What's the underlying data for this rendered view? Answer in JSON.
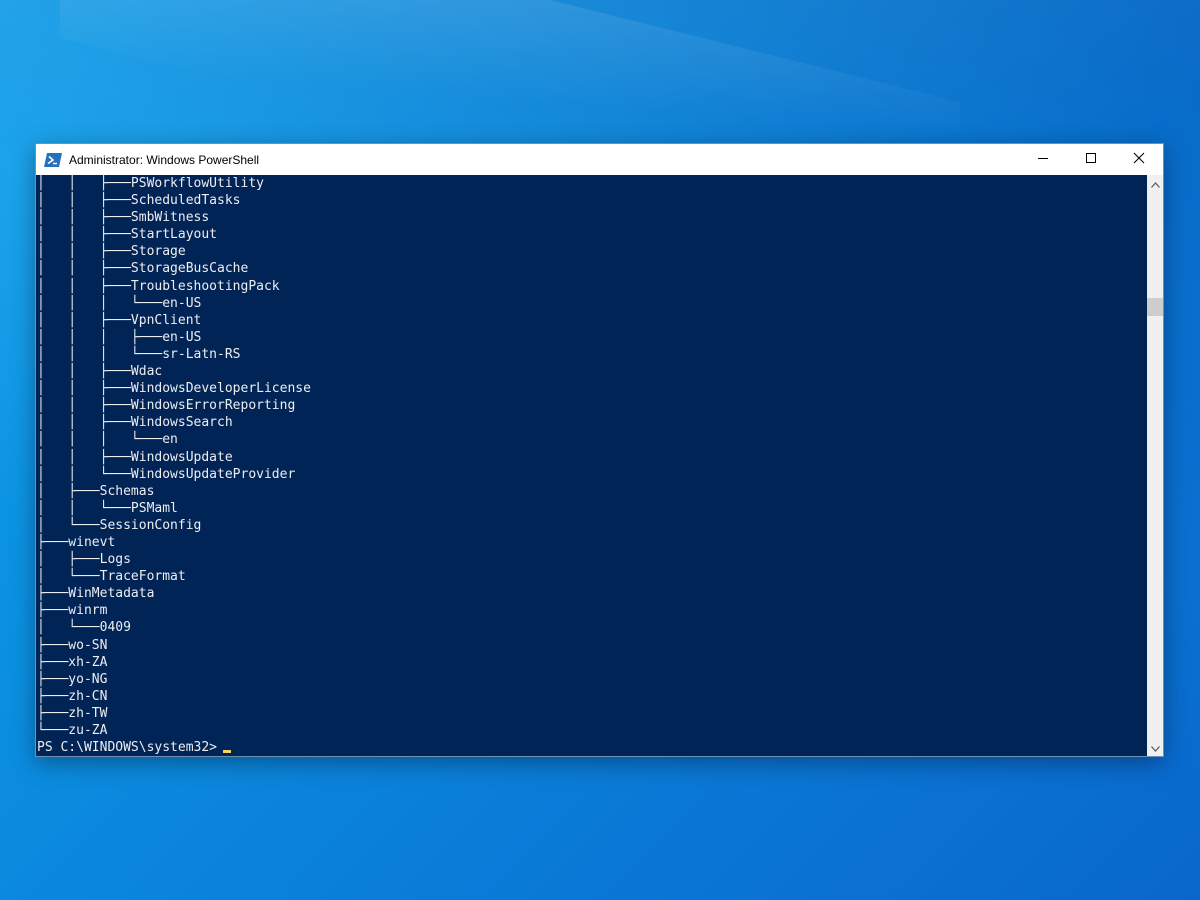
{
  "window": {
    "title": "Administrator: Windows PowerShell",
    "icon": "powershell-icon",
    "controls": [
      "minimize-icon",
      "maximize-icon",
      "close-icon"
    ]
  },
  "terminal": {
    "background": "#012456",
    "text_color": "#eeedf0",
    "cursor_color": "#f2d55c",
    "lines": [
      "│   │   ├───PSWorkflowUtility",
      "│   │   ├───ScheduledTasks",
      "│   │   ├───SmbWitness",
      "│   │   ├───StartLayout",
      "│   │   ├───Storage",
      "│   │   ├───StorageBusCache",
      "│   │   ├───TroubleshootingPack",
      "│   │   │   └───en-US",
      "│   │   ├───VpnClient",
      "│   │   │   ├───en-US",
      "│   │   │   └───sr-Latn-RS",
      "│   │   ├───Wdac",
      "│   │   ├───WindowsDeveloperLicense",
      "│   │   ├───WindowsErrorReporting",
      "│   │   ├───WindowsSearch",
      "│   │   │   └───en",
      "│   │   ├───WindowsUpdate",
      "│   │   └───WindowsUpdateProvider",
      "│   ├───Schemas",
      "│   │   └───PSMaml",
      "│   └───SessionConfig",
      "├───winevt",
      "│   ├───Logs",
      "│   └───TraceFormat",
      "├───WinMetadata",
      "├───winrm",
      "│   └───0409",
      "├───wo-SN",
      "├───xh-ZA",
      "├───yo-NG",
      "├───zh-CN",
      "├───zh-TW",
      "└───zu-ZA"
    ],
    "prompt": "PS C:\\WINDOWS\\system32>"
  },
  "scrollbar": {
    "up_icon": "scroll-up-arrow-icon",
    "down_icon": "scroll-down-arrow-icon",
    "position_fraction": 0.2
  }
}
